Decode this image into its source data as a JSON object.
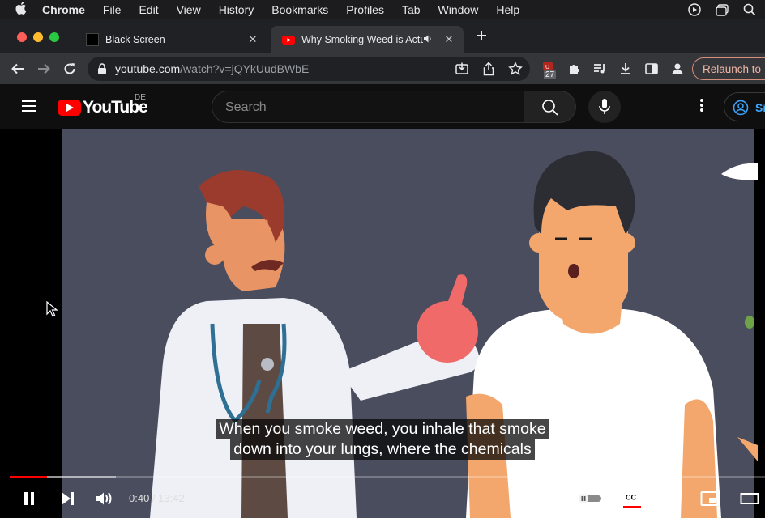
{
  "menubar": {
    "app": "Chrome",
    "items": [
      "File",
      "Edit",
      "View",
      "History",
      "Bookmarks",
      "Profiles",
      "Tab",
      "Window",
      "Help"
    ]
  },
  "tabs": [
    {
      "title": "Black Screen",
      "close": "✕"
    },
    {
      "title": "Why Smoking Weed is Actu",
      "close": "✕"
    }
  ],
  "toolbar": {
    "url_host": "youtube.com",
    "url_path": "/watch?v=jQYkUudBWbE",
    "extension_badge": "27",
    "relaunch_label": "Relaunch to"
  },
  "youtube": {
    "logo_text": "YouTube",
    "country_code": "DE",
    "search_placeholder": "Search",
    "signin_label": "Si"
  },
  "player": {
    "captions": [
      "When you smoke weed, you inhale that smoke",
      "down into your lungs, where the chemicals"
    ],
    "current_time": "0:40",
    "duration": "13:42",
    "time_display": "0:40 / 13:42",
    "played_fraction": 0.049,
    "buffered_fraction": 0.141,
    "accent_color": "#ff0000"
  },
  "colors": {
    "menubar_bg": "#1c1c1e",
    "tabstrip_bg": "#202124",
    "toolbar_bg": "#35363a",
    "yt_header_bg": "#0f0f0f",
    "video_bg": "#4a4d5e"
  }
}
